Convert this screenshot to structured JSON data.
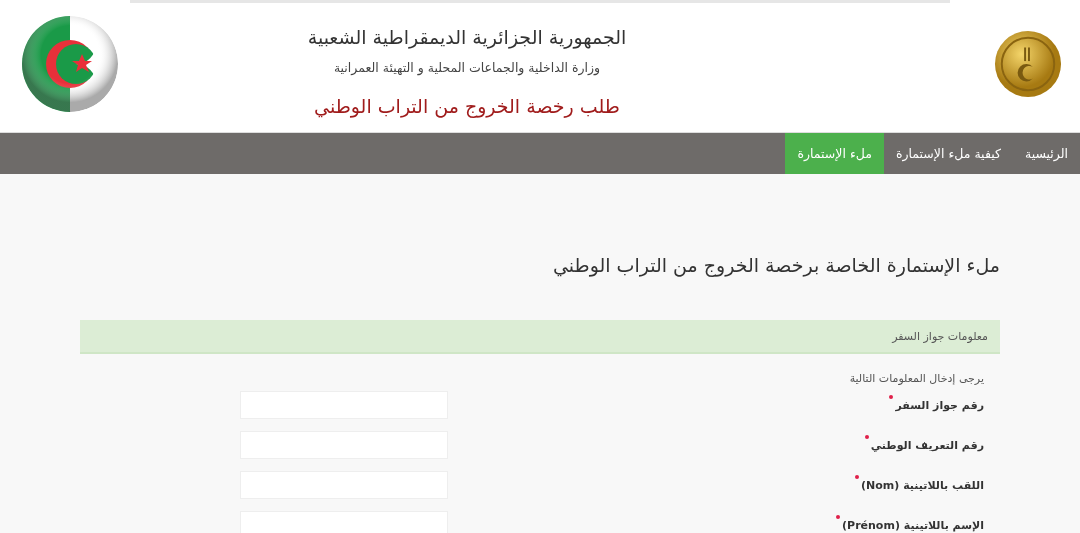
{
  "header": {
    "title": "الجمهورية الجزائرية الديمقراطية الشعبية",
    "subtitle": "وزارة الداخلية والجماعات المحلية و التهيئة العمرانية",
    "service": "طلب رخصة الخروج من التراب الوطني"
  },
  "nav": [
    {
      "label": "الرئيسية",
      "selected": false
    },
    {
      "label": "كيفية ملء الإستمارة",
      "selected": false
    },
    {
      "label": "ملء الإستمارة",
      "selected": true
    }
  ],
  "page_title": "ملء الإستمارة الخاصة برخصة الخروج من التراب الوطني",
  "section": "معلومات جواز السفر",
  "instruction": "يرجى إدخال المعلومات التالية",
  "fields": [
    {
      "label": "رقم جواز السفر",
      "required": true
    },
    {
      "label": "رقم التعريف الوطني",
      "required": true
    },
    {
      "label": "اللقب باللاتينية (Nom)",
      "required": true
    },
    {
      "label": "الإسم باللاتينية (Prénom)",
      "required": true
    }
  ]
}
